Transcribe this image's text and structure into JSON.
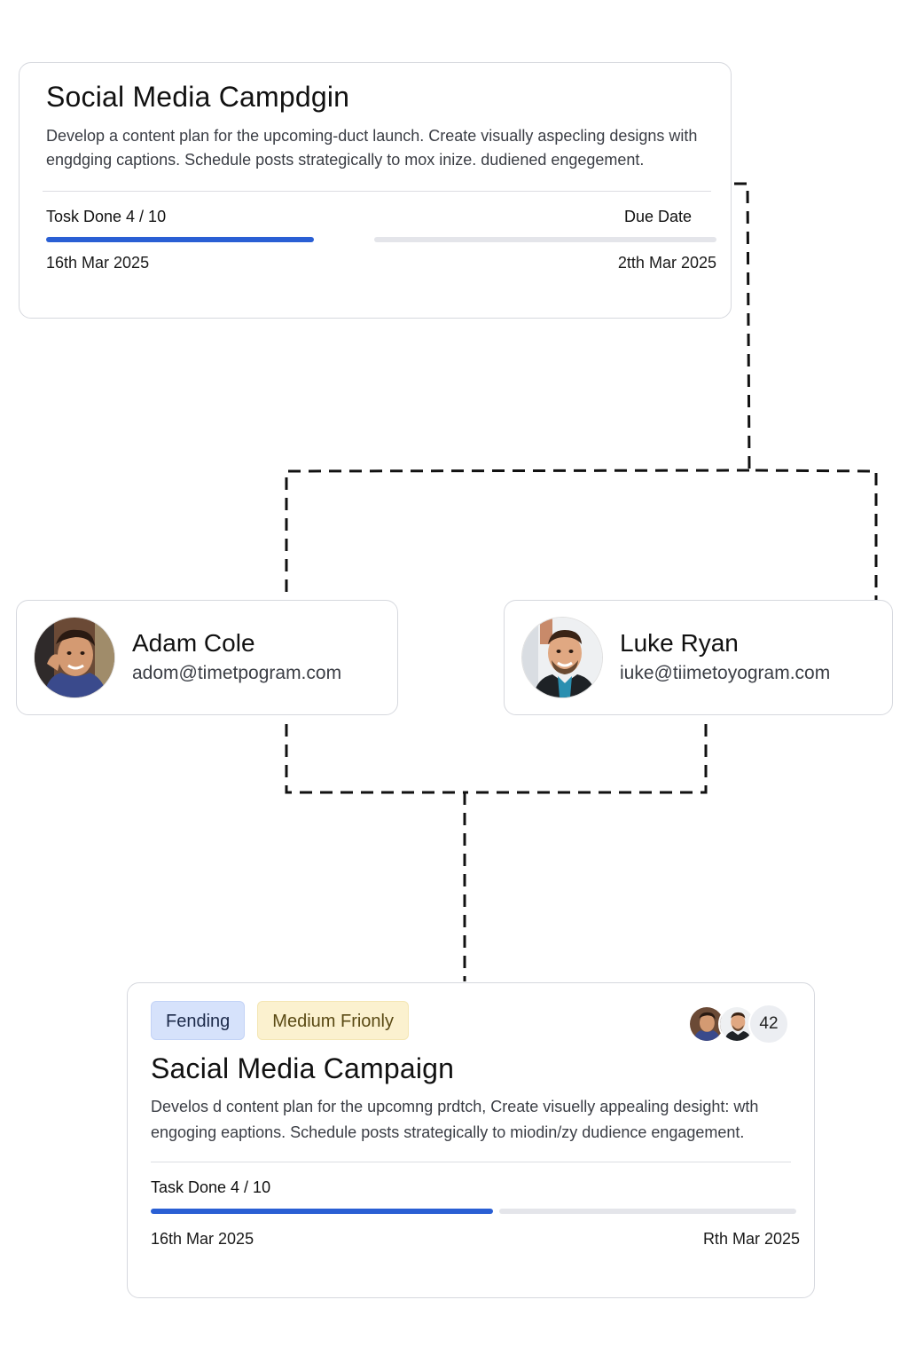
{
  "top_task": {
    "title": "Social Media Campdgin",
    "description": "Develop a content plan for the upcoming-duct launch. Create visually aspecling designs with engdging captions. Schedule posts strategically to mox inize. dudiened engegement.",
    "tasks_label": "Tosk Done 4 / 10",
    "due_label": "Due Date",
    "progress_fraction": 0.4,
    "start_date": "16th Mar 2025",
    "due_date": "2tth Mar 2025"
  },
  "people": [
    {
      "name": "Adam Cole",
      "email": "adom@timetpogram.com",
      "avatar_icon": "person-photo-avatar"
    },
    {
      "name": "Luke Ryan",
      "email": "iuke@tiimetoyogram.com",
      "avatar_icon": "person-photo-avatar"
    }
  ],
  "bottom_task": {
    "status": "Fending",
    "priority": "Medium Frionly",
    "assignee_count": "42",
    "title": "Sacial Media Campaign",
    "description": "Develos d content plan for the upcomng prdtch, Create visuelly appealing desight: wth engoging eaptions. Schedule posts strategically to miodin/zy dudience engagement.",
    "tasks_label": "Task Done 4 / 10",
    "progress_fraction": 0.4,
    "start_date": "16th Mar 2025",
    "end_date": "Rth Mar 2025"
  },
  "colors": {
    "progress_fill": "#2a5fd4",
    "progress_track": "#e4e5ea",
    "status_badge_bg": "#d6e2fb",
    "priority_badge_bg": "#fbf1cf",
    "card_border": "#d6d8de",
    "connector": "#111111"
  }
}
